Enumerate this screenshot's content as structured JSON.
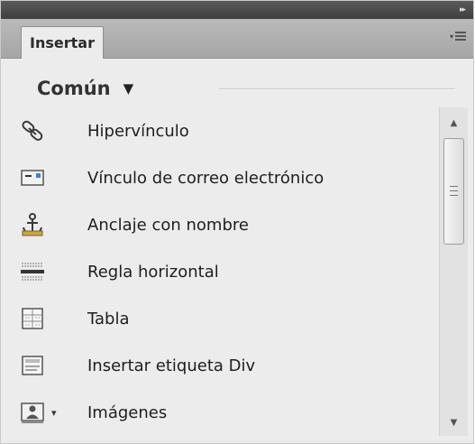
{
  "panel": {
    "tab_label": "Insertar",
    "collapse_glyph": "▸▸",
    "menu_glyph": "▾"
  },
  "category": {
    "label": "Común",
    "arrow": "▼"
  },
  "items": [
    {
      "label": "Hipervínculo",
      "icon": "hyperlink-icon"
    },
    {
      "label": "Vínculo de correo electrónico",
      "icon": "email-link-icon"
    },
    {
      "label": "Anclaje con nombre",
      "icon": "named-anchor-icon"
    },
    {
      "label": "Regla horizontal",
      "icon": "horizontal-rule-icon"
    },
    {
      "label": "Tabla",
      "icon": "table-icon"
    },
    {
      "label": "Insertar etiqueta Div",
      "icon": "div-tag-icon"
    },
    {
      "label": "Imágenes",
      "icon": "image-icon",
      "dropdown": "▾"
    }
  ],
  "scrollbar": {
    "up_glyph": "▲",
    "down_glyph": "▼",
    "position": 0
  },
  "colors": {
    "panel_bg": "#ececec",
    "topbar": "#4a4a4a",
    "tabrow": "#b1b1b1",
    "text": "#1e1e1e"
  }
}
